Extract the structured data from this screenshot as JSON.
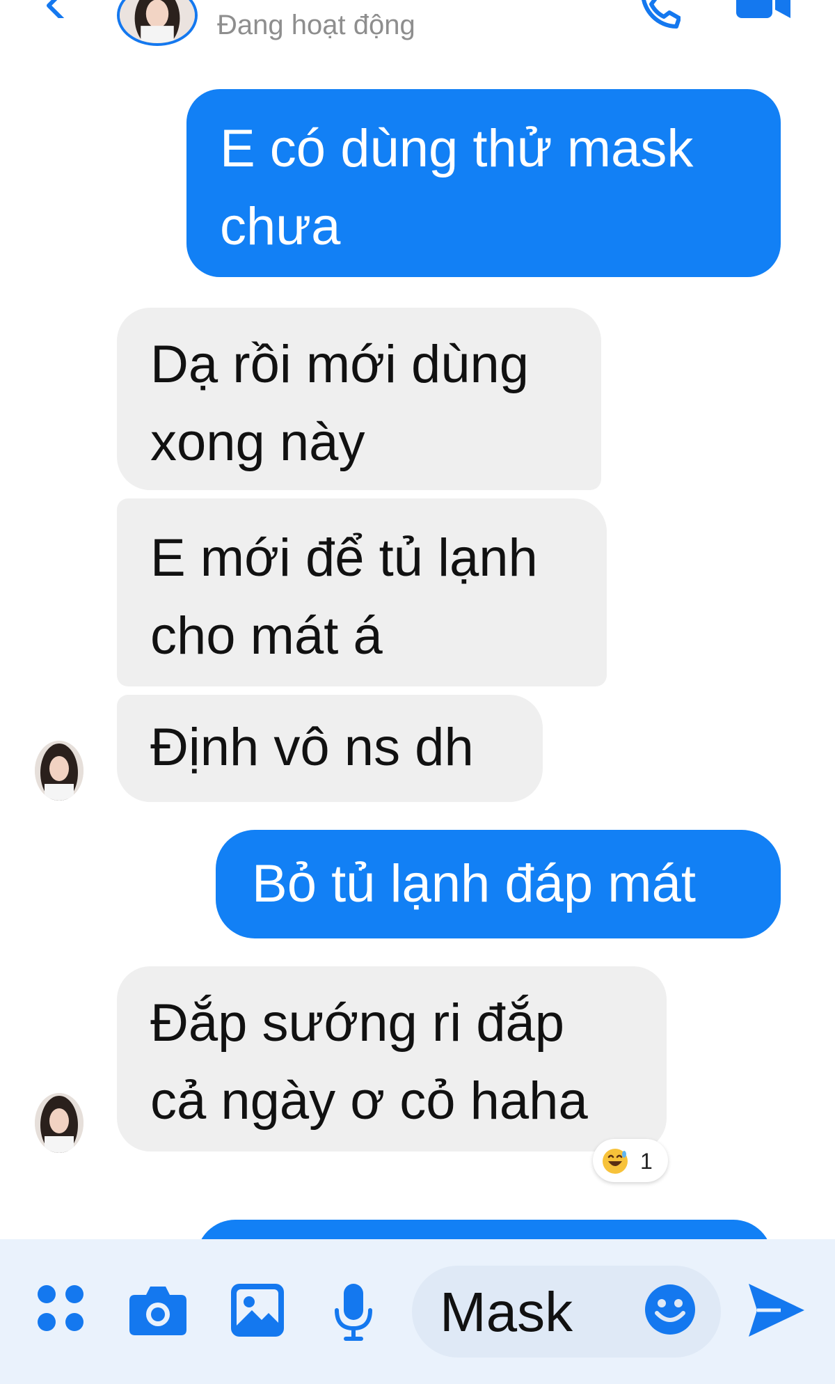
{
  "header": {
    "status": "Đang hoạt động",
    "icons": {
      "back": "chevron-left-icon",
      "call": "phone-icon",
      "video": "video-camera-icon"
    }
  },
  "messages": [
    {
      "direction": "sent",
      "lines": [
        "E có dùng thử mask",
        "chưa"
      ]
    },
    {
      "direction": "received",
      "lines": [
        "Dạ rồi mới dùng",
        "xong này"
      ]
    },
    {
      "direction": "received",
      "lines": [
        "E mới để tủ lạnh",
        "cho mát á"
      ]
    },
    {
      "direction": "received",
      "lines": [
        "Định vô ns dh"
      ]
    },
    {
      "direction": "sent",
      "lines": [
        "Bỏ tủ lạnh đáp mát"
      ]
    },
    {
      "direction": "received",
      "lines": [
        "Đắp sướng ri đắp",
        "cả ngày ơ cỏ haha"
      ],
      "reaction": {
        "emoji": "grinning-sweat-icon",
        "count": "1"
      }
    }
  ],
  "composer": {
    "input_value": "Mask",
    "icons": [
      "more-actions-icon",
      "camera-icon",
      "image-icon",
      "microphone-icon",
      "emoji-icon",
      "send-icon"
    ]
  },
  "colors": {
    "sent_bubble": "#1280f5",
    "received_bubble": "#efefef",
    "accent": "#1478ef",
    "composer_bg": "#eaf2fc"
  }
}
